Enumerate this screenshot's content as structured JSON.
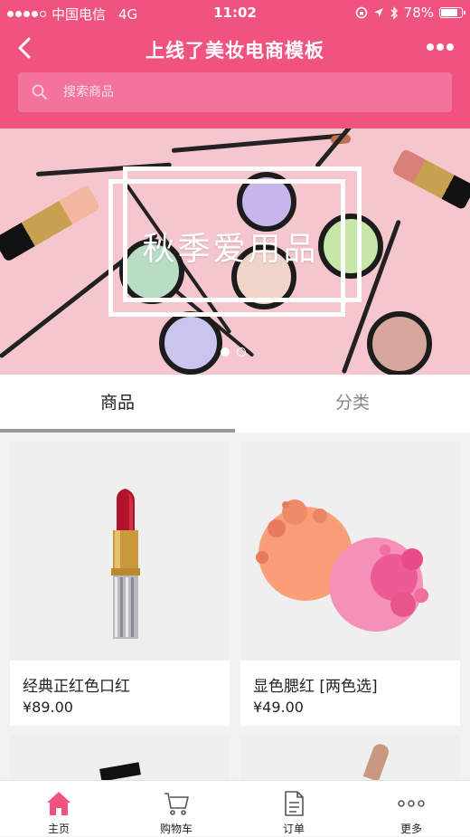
{
  "status_bar": {
    "carrier": "中国电信",
    "network": "4G",
    "time": "11:02",
    "battery": "78%"
  },
  "navbar": {
    "title": "上线了美妆电商模板",
    "accent_color": "#f0537f"
  },
  "search": {
    "placeholder": "搜索商品",
    "value": ""
  },
  "banner": {
    "title": "秋季爱用品",
    "slide_count": 2,
    "active_slide": 1
  },
  "tabs": [
    {
      "label": "商品",
      "active": true
    },
    {
      "label": "分类",
      "active": false
    }
  ],
  "products": [
    {
      "name": "经典正红色口红",
      "price": "¥89.00",
      "image_icon": "lipstick-image"
    },
    {
      "name": "显色腮红 [两色选]",
      "price": "¥49.00",
      "image_icon": "blush-image"
    }
  ],
  "tab_bar": [
    {
      "label": "主页",
      "icon": "home-icon",
      "active": true
    },
    {
      "label": "购物车",
      "icon": "cart-icon",
      "active": false
    },
    {
      "label": "订单",
      "icon": "order-icon",
      "active": false
    },
    {
      "label": "更多",
      "icon": "more-icon",
      "active": false
    }
  ]
}
